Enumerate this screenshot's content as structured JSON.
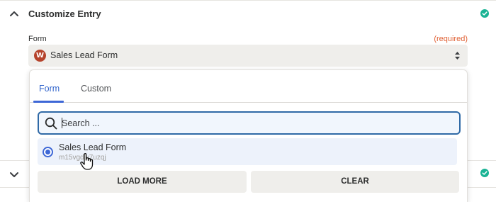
{
  "section": {
    "title": "Customize Entry",
    "form_label": "Form",
    "required_label": "(required)",
    "selected_value": "Sales Lead Form",
    "app_logo_letter": "W"
  },
  "popup": {
    "tabs": [
      {
        "label": "Form",
        "active": true
      },
      {
        "label": "Custom",
        "active": false
      }
    ],
    "search": {
      "placeholder": "Search ...",
      "value": ""
    },
    "options": [
      {
        "title": "Sales Lead Form",
        "id": "m15vgdw7uzqj",
        "selected": true
      }
    ],
    "load_more_label": "LOAD MORE",
    "clear_label": "CLEAR"
  },
  "icons": {
    "collapse": "chevron-up-icon",
    "expand": "chevron-down-icon",
    "status": "check-circle-icon",
    "sort": "sort-arrows-icon",
    "search": "search-icon",
    "cursor": "hand-pointer-icon"
  },
  "colors": {
    "accent": "#3d67d6",
    "success": "#1ab394",
    "required": "#e06236",
    "app_logo": "#b5432c"
  }
}
